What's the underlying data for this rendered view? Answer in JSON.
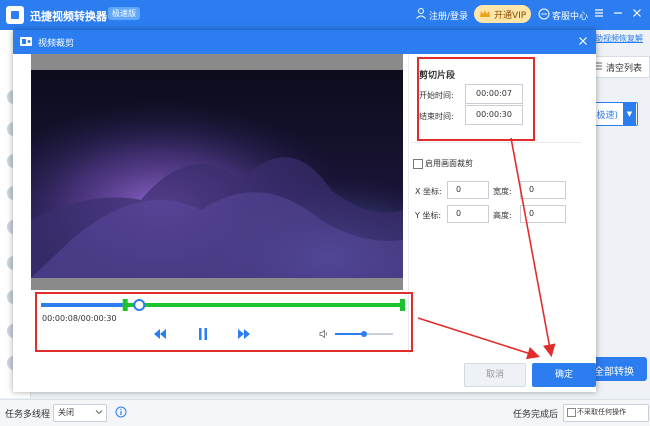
{
  "app": {
    "title": "迅捷视频转换器",
    "edition": "极速版",
    "login": "注册/登录",
    "vip": "开通VIP",
    "service": "客服中心"
  },
  "background": {
    "link": "助视频恢复解",
    "clear_list": "清空列表",
    "format": "(极速)",
    "convert_all": "全部转换"
  },
  "dialog": {
    "title": "视频裁剪",
    "clip": {
      "title": "剪切片段",
      "start_label": "开始时间:",
      "start_value": "00:00:07",
      "end_label": "结束时间:",
      "end_value": "00:00:30"
    },
    "crop": {
      "enable_label": "启用画面裁剪",
      "x_label": "X 坐标:",
      "x_value": "0",
      "width_label": "宽度:",
      "width_value": "0",
      "y_label": "Y 坐标:",
      "y_value": "0",
      "height_label": "高度:",
      "height_value": "0"
    },
    "player": {
      "time": "00:00:08/00:00:30",
      "progress_fraction": 0.27,
      "clip_start_fraction": 0.23,
      "clip_end_fraction": 1.0,
      "volume_fraction": 0.5
    },
    "cancel": "取消",
    "ok": "确定"
  },
  "statusbar": {
    "multi_label": "任务多线程",
    "multi_value": "关闭",
    "after_label": "任务完成后",
    "after_value": "不采取任何操作"
  },
  "colors": {
    "brand_blue": "#2b7df0",
    "clip_green": "#1bc42e",
    "annotation_red": "#e22d2d"
  }
}
